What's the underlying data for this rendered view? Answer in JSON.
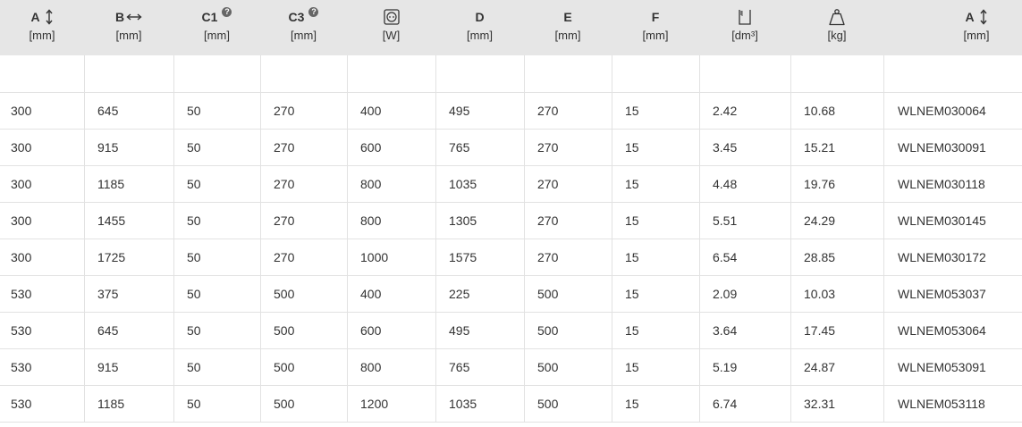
{
  "header": {
    "columns": [
      {
        "label": "A",
        "unit": "[mm]",
        "icon": "vertical-arrow-icon"
      },
      {
        "label": "B",
        "unit": "[mm]",
        "icon": "horizontal-arrow-icon"
      },
      {
        "label": "C1",
        "unit": "[mm]",
        "icon": "help-icon",
        "help": "?"
      },
      {
        "label": "C3",
        "unit": "[mm]",
        "icon": "help-icon",
        "help": "?"
      },
      {
        "label": "",
        "unit": "[W]",
        "icon": "power-socket-icon"
      },
      {
        "label": "D",
        "unit": "[mm]"
      },
      {
        "label": "E",
        "unit": "[mm]"
      },
      {
        "label": "F",
        "unit": "[mm]"
      },
      {
        "label": "",
        "unit": "[dm³]",
        "icon": "water-volume-icon"
      },
      {
        "label": "",
        "unit": "[kg]",
        "icon": "weight-icon"
      },
      {
        "label": "A",
        "unit": "[mm]",
        "icon": "vertical-arrow-icon"
      }
    ]
  },
  "rows": [
    [
      "300",
      "645",
      "50",
      "270",
      "400",
      "495",
      "270",
      "15",
      "2.42",
      "10.68",
      "WLNEM030064"
    ],
    [
      "300",
      "915",
      "50",
      "270",
      "600",
      "765",
      "270",
      "15",
      "3.45",
      "15.21",
      "WLNEM030091"
    ],
    [
      "300",
      "1185",
      "50",
      "270",
      "800",
      "1035",
      "270",
      "15",
      "4.48",
      "19.76",
      "WLNEM030118"
    ],
    [
      "300",
      "1455",
      "50",
      "270",
      "800",
      "1305",
      "270",
      "15",
      "5.51",
      "24.29",
      "WLNEM030145"
    ],
    [
      "300",
      "1725",
      "50",
      "270",
      "1000",
      "1575",
      "270",
      "15",
      "6.54",
      "28.85",
      "WLNEM030172"
    ],
    [
      "530",
      "375",
      "50",
      "500",
      "400",
      "225",
      "500",
      "15",
      "2.09",
      "10.03",
      "WLNEM053037"
    ],
    [
      "530",
      "645",
      "50",
      "500",
      "600",
      "495",
      "500",
      "15",
      "3.64",
      "17.45",
      "WLNEM053064"
    ],
    [
      "530",
      "915",
      "50",
      "500",
      "800",
      "765",
      "500",
      "15",
      "5.19",
      "24.87",
      "WLNEM053091"
    ],
    [
      "530",
      "1185",
      "50",
      "500",
      "1200",
      "1035",
      "500",
      "15",
      "6.74",
      "32.31",
      "WLNEM053118"
    ]
  ],
  "colors": {
    "header_bg": "#e6e6e6",
    "border": "#e2e2e2",
    "text": "#333333"
  }
}
